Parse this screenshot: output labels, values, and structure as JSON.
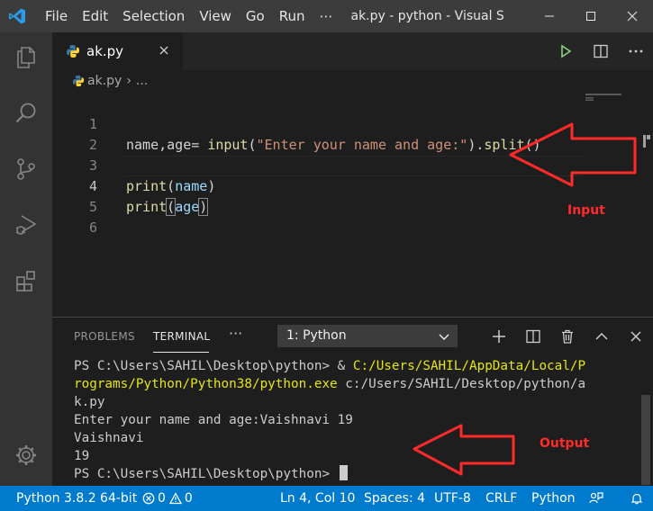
{
  "menu": [
    "File",
    "Edit",
    "Selection",
    "View",
    "Go",
    "Run",
    "⋯"
  ],
  "window_title": "ak.py - python - Visual S...",
  "tab": {
    "label": "ak.py"
  },
  "breadcrumb": {
    "file": "ak.py",
    "separator": "›",
    "rest": "..."
  },
  "code_lines": [
    {
      "n": "1",
      "text": "name,age= input(\"Enter your name and age:\").split()"
    },
    {
      "n": "2",
      "text": ""
    },
    {
      "n": "3",
      "text": "print(name)"
    },
    {
      "n": "4",
      "text": "print(age)"
    },
    {
      "n": "5",
      "text": ""
    },
    {
      "n": "6",
      "text": ""
    }
  ],
  "code_tokens": {
    "l1_a": "name,age= ",
    "l1_fn": "input",
    "l1_p1": "(",
    "l1_str": "\"Enter your name and age:\"",
    "l1_p2": ").",
    "l1_fn2": "split",
    "l1_p3": "()",
    "l3_fn": "print",
    "l3_p1": "(",
    "l3_var": "name",
    "l3_p2": ")",
    "l4_fn": "print",
    "l4_p1": "(",
    "l4_var": "age",
    "l4_p2": ")"
  },
  "annotations": {
    "input": "Input",
    "output": "Output",
    "color": "#ff2a2a"
  },
  "panel": {
    "tabs": [
      "PROBLEMS",
      "TERMINAL"
    ],
    "more": "···",
    "terminal_select": "1: Python"
  },
  "terminal": {
    "l1_prompt": "PS C:\\Users\\SAHIL\\Desktop\\python> & ",
    "l1_path": "C:/Users/SAHIL/AppData/Local/P",
    "l2_path": "rograms/Python/Python38/python.exe",
    "l2_rest": " c:/Users/SAHIL/Desktop/python/a",
    "l3": "k.py",
    "l4": "Enter your name and age:Vaishnavi 19",
    "l5": "Vaishnavi",
    "l6": "19",
    "l7": "PS C:\\Users\\SAHIL\\Desktop\\python> "
  },
  "status": {
    "interpreter": "Python 3.8.2 64-bit",
    "errors": "0",
    "warnings": "0",
    "position": "Ln 4, Col 10",
    "spaces": "Spaces: 4",
    "encoding": "UTF-8",
    "eol": "CRLF",
    "language": "Python"
  },
  "colors": {
    "titlebar": "#3c3c3c",
    "activity": "#333333",
    "editor": "#1e1e1e",
    "statusbar": "#007acc",
    "run": "#89d185"
  }
}
